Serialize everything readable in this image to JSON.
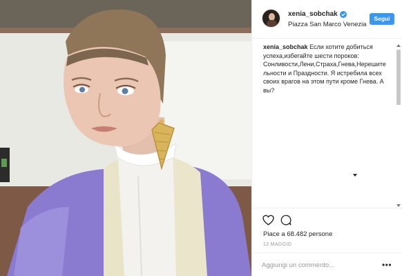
{
  "post": {
    "image_alt": "Photo"
  },
  "header": {
    "username": "xenia_sobchak",
    "location": "Piazza San Marco Venezia",
    "follow_label": "Segui",
    "verified_icon": "verified-badge-icon",
    "accent_color": "#3897f0"
  },
  "caption": {
    "username": "xenia_sobchak",
    "text": "Если хотите добиться успеха,избегайте шести пороков: Сонливости,Лени,Страха,Гнева,Нерешительности и Праздности. Я истребила всех своих врагов на этом пути кроме Гнева. А вы?"
  },
  "actions": {
    "like_icon": "heart-icon",
    "comment_icon": "comment-icon"
  },
  "likes": {
    "text": "Piace a 68.482 persone"
  },
  "date": {
    "text": "12 MAGGIO"
  },
  "comment_box": {
    "placeholder": "Aggiungi un commento...",
    "more_label": "•••"
  }
}
